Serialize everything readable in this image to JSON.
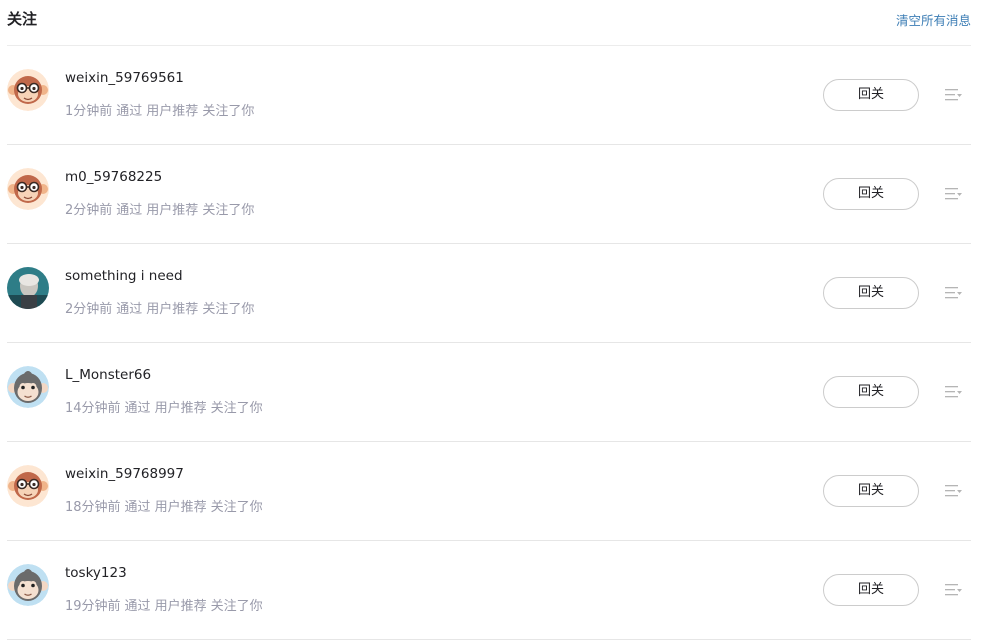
{
  "header": {
    "title": "关注",
    "clear_all": "清空所有消息"
  },
  "items": [
    {
      "username": "weixin_59769561",
      "time": "1分钟前",
      "via": "通过",
      "source": "用户推荐",
      "action": "关注了你",
      "button": "回关",
      "avatar": "monkey-glasses"
    },
    {
      "username": "m0_59768225",
      "time": "2分钟前",
      "via": "通过",
      "source": "用户推荐",
      "action": "关注了你",
      "button": "回关",
      "avatar": "monkey-glasses"
    },
    {
      "username": "something i need",
      "time": "2分钟前",
      "via": "通过",
      "source": "用户推荐",
      "action": "关注了你",
      "button": "回关",
      "avatar": "photo"
    },
    {
      "username": "L_Monster66",
      "time": "14分钟前",
      "via": "通过",
      "source": "用户推荐",
      "action": "关注了你",
      "button": "回关",
      "avatar": "monkey-blue"
    },
    {
      "username": "weixin_59768997",
      "time": "18分钟前",
      "via": "通过",
      "source": "用户推荐",
      "action": "关注了你",
      "button": "回关",
      "avatar": "monkey-glasses"
    },
    {
      "username": "tosky123",
      "time": "19分钟前",
      "via": "通过",
      "source": "用户推荐",
      "action": "关注了你",
      "button": "回关",
      "avatar": "monkey-blue"
    }
  ],
  "colors": {
    "link": "#3d7eb5",
    "meta": "#999aaa",
    "divider": "#e6e6e6"
  }
}
